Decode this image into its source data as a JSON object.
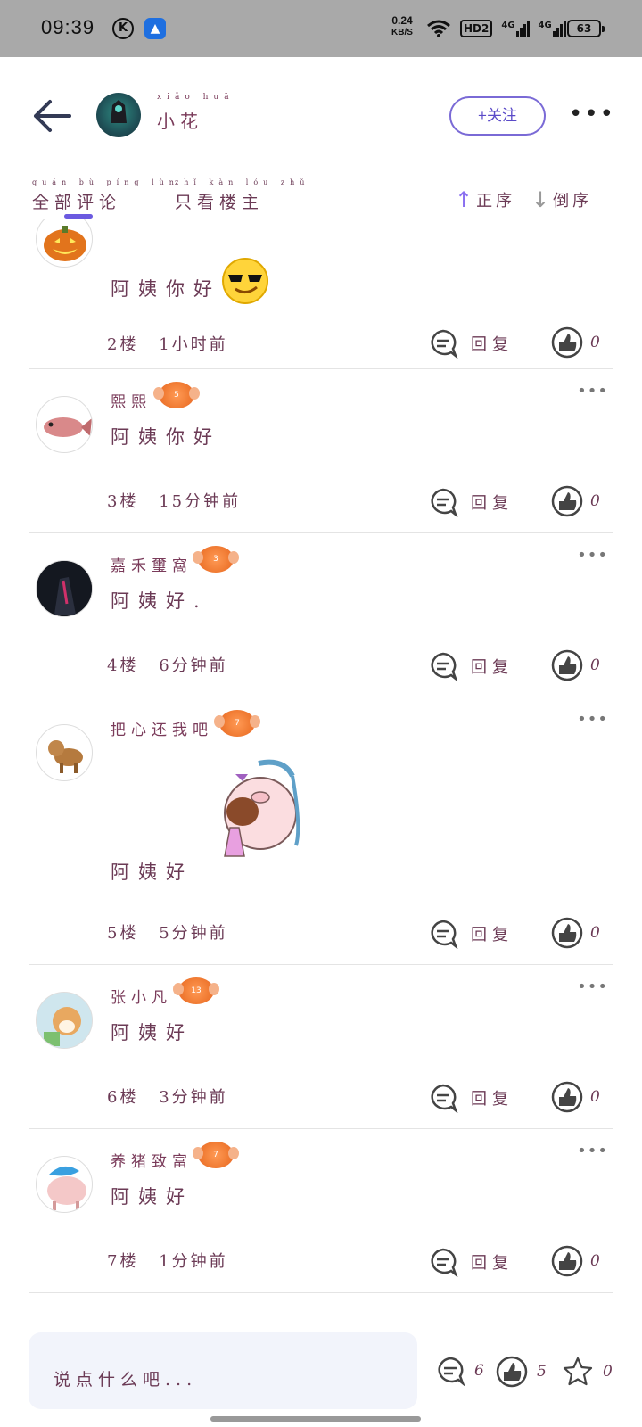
{
  "status": {
    "time": "09:39",
    "net_speed": "0.24",
    "net_unit": "KB/S",
    "hd_label": "HD2",
    "sig1": "4G",
    "sig2": "4G",
    "battery": "63"
  },
  "header": {
    "user_name": "小花",
    "user_name_pinyin": "xiǎo huā",
    "follow_label": "+关注"
  },
  "tabs": {
    "all_comments": "全部评论",
    "all_comments_pinyin": "quán bù píng lùn",
    "owner_only": "只看楼主",
    "owner_only_pinyin": "zhǐ kàn lóu zhǔ",
    "sort_asc": "正序",
    "sort_desc": "倒序"
  },
  "comments": [
    {
      "name": "",
      "badge": "",
      "text": "阿姨你好",
      "floor": "2楼",
      "time": "1小时前",
      "reply": "回复",
      "likes": "0"
    },
    {
      "name": "熙熙",
      "badge": "5",
      "text": "阿姨你好",
      "floor": "3楼",
      "time": "15分钟前",
      "reply": "回复",
      "likes": "0"
    },
    {
      "name": "嘉禾璽窩",
      "badge": "3",
      "text": "阿姨好.",
      "floor": "4楼",
      "time": "6分钟前",
      "reply": "回复",
      "likes": "0"
    },
    {
      "name": "把心还我吧",
      "badge": "7",
      "text": "阿姨好",
      "floor": "5楼",
      "time": "5分钟前",
      "reply": "回复",
      "likes": "0"
    },
    {
      "name": "张小凡",
      "badge": "13",
      "text": "阿姨好",
      "floor": "6楼",
      "time": "3分钟前",
      "reply": "回复",
      "likes": "0"
    },
    {
      "name": "养猪致富",
      "badge": "7",
      "text": "阿姨好",
      "floor": "7楼",
      "time": "1分钟前",
      "reply": "回复",
      "likes": "0"
    }
  ],
  "bottom": {
    "placeholder": "说点什么吧...",
    "comment_count": "6",
    "like_count": "5",
    "fav_count": "0"
  },
  "colors": {
    "accent": "#6b5ae0",
    "text": "#6b3a55",
    "badge": "#f07a32"
  }
}
